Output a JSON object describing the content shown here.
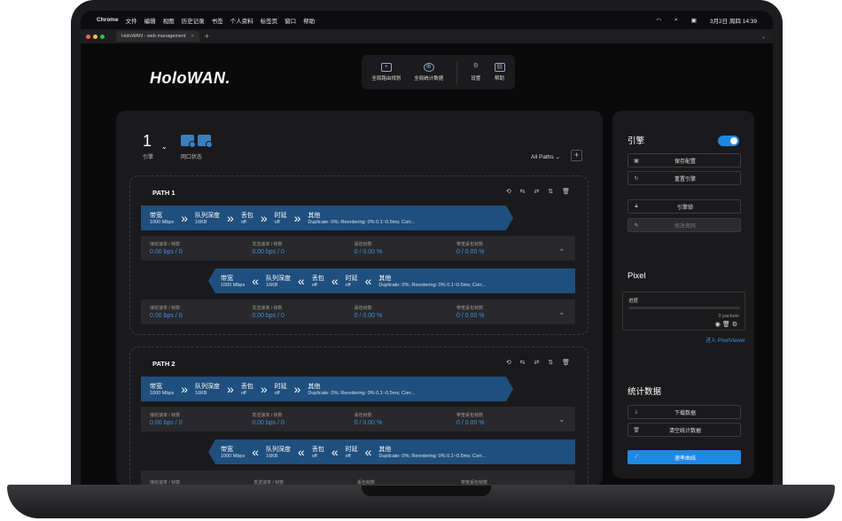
{
  "menubar": {
    "apple": "",
    "app": "Chrome",
    "items": [
      "文件",
      "编辑",
      "视图",
      "历史记录",
      "书签",
      "个人资料",
      "标签页",
      "窗口",
      "帮助"
    ],
    "datetime": "3月2日 周四 14:39"
  },
  "browser": {
    "tab_title": "HoloWAN - web management",
    "tab_close": "×",
    "new_tab": "+",
    "menu_chevron": "⌄"
  },
  "app": {
    "logo": "HoloWAN.",
    "nav": [
      {
        "label": "全局路由规划",
        "icon": "plus-square-icon",
        "glyph": "+"
      },
      {
        "label": "全局统计数据",
        "icon": "globe-icon",
        "glyph": "⊕"
      },
      {
        "label": "设置",
        "icon": "gear-icon",
        "glyph": "⚙"
      },
      {
        "label": "帮助",
        "icon": "book-icon",
        "glyph": "▤"
      }
    ]
  },
  "engine": {
    "number": "1",
    "caret": "⌄",
    "label": "引擎",
    "port_label": "网口状态",
    "all_paths": "All Paths ⌄",
    "add": "+"
  },
  "paths": [
    {
      "title": "PATH 1",
      "tools": "⟲ ⇆ ⇄ ⇅ 🗑",
      "fwd": {
        "bw_label": "带宽",
        "bw_value": "1000 Mbps",
        "q_label": "队列深度",
        "q_value": "16KB",
        "loss_label": "丢包",
        "loss_value": "off",
        "lat_label": "时延",
        "lat_value": "off",
        "other_label": "其他",
        "other_value": "Duplicate: 0%; Reordering: 0% 0.1~0.5ms; Corr..."
      },
      "fwd_stats": [
        {
          "label": "接收速率 / 帧数",
          "value": "0.00 bps / 0"
        },
        {
          "label": "发送速率 / 帧数",
          "value": "0.00 bps / 0"
        },
        {
          "label": "丢包帧数",
          "value": "0 / 0.00 %"
        },
        {
          "label": "带宽丢包帧数",
          "value": "0 / 0.00 %"
        }
      ],
      "rev": {
        "bw_label": "带宽",
        "bw_value": "1000 Mbps",
        "q_label": "队列深度",
        "q_value": "16KB",
        "loss_label": "丢包",
        "loss_value": "off",
        "lat_label": "时延",
        "lat_value": "off",
        "other_label": "其他",
        "other_value": "Duplicate: 0%; Reordering: 0% 0.1~0.5ms; Corr..."
      },
      "rev_stats": [
        {
          "label": "接收速率 / 帧数",
          "value": "0.00 bps / 0"
        },
        {
          "label": "发送速率 / 帧数",
          "value": "0.00 bps / 0"
        },
        {
          "label": "丢包帧数",
          "value": "0 / 0.00 %"
        },
        {
          "label": "带宽丢包帧数",
          "value": "0 / 0.00 %"
        }
      ]
    },
    {
      "title": "PATH 2",
      "tools": "⟲ ⇆ ⇄ ⇅ 🗑",
      "fwd": {
        "bw_label": "带宽",
        "bw_value": "1000 Mbps",
        "q_label": "队列深度",
        "q_value": "16KB",
        "loss_label": "丢包",
        "loss_value": "off",
        "lat_label": "时延",
        "lat_value": "off",
        "other_label": "其他",
        "other_value": "Duplicate: 0%; Reordering: 0% 0.1~0.5ms; Corr..."
      },
      "fwd_stats": [
        {
          "label": "接收速率 / 帧数",
          "value": "0.00 bps / 0"
        },
        {
          "label": "发送速率 / 帧数",
          "value": "0.00 bps / 0"
        },
        {
          "label": "丢包帧数",
          "value": "0 / 0.00 %"
        },
        {
          "label": "带宽丢包帧数",
          "value": "0 / 0.00 %"
        }
      ],
      "rev": {
        "bw_label": "带宽",
        "bw_value": "1000 Mbps",
        "q_label": "队列深度",
        "q_value": "16KB",
        "loss_label": "丢包",
        "loss_value": "off",
        "lat_label": "时延",
        "lat_value": "off",
        "other_label": "其他",
        "other_value": "Duplicate: 0%; Reordering: 0% 0.1~0.5ms; Corr..."
      },
      "rev_stats": [
        {
          "label": "接收速率 / 帧数",
          "value": ""
        },
        {
          "label": "发送速率 / 帧数",
          "value": ""
        },
        {
          "label": "丢包帧数",
          "value": ""
        },
        {
          "label": "带宽丢包帧数",
          "value": ""
        }
      ]
    }
  ],
  "side": {
    "engine_title": "引擎",
    "engine_enabled": true,
    "save": "保存配置",
    "reset": "重置引擎",
    "lock": "引擎锁",
    "change_pw": "修改密码",
    "pixel_title": "Pixel",
    "progress_label": "进度",
    "progress": 0,
    "packets": "0 packets",
    "pixel_link": "进入 PixelViewer",
    "stats_title": "统计数据",
    "download": "下载数据",
    "clear": "清空统计数据",
    "rate_curve": "速率曲线"
  },
  "colors": {
    "accent": "#1e88e5",
    "band": "#1f4f7e",
    "value": "#3a8fe0"
  }
}
